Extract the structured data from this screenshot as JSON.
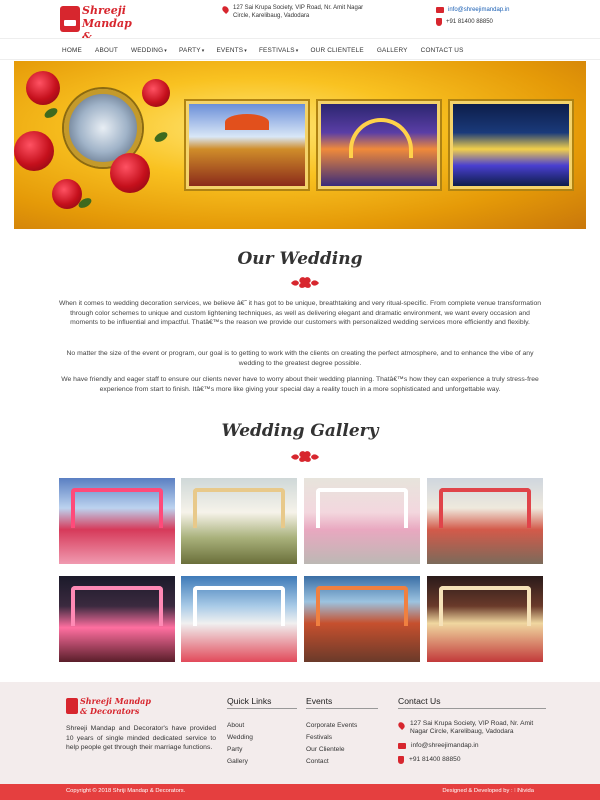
{
  "brand": {
    "name_line1": "Shreeji Mandap",
    "name_line2": "& Decorators"
  },
  "header": {
    "address": "127 Sai Krupa Society, VIP Road, Nr. Amit Nagar Circle, Karelibaug, Vadodara",
    "email": "info@shreejimandap.in",
    "phone": "+91 81400 88850"
  },
  "nav": [
    {
      "label": "HOME",
      "caret": ""
    },
    {
      "label": "ABOUT",
      "caret": ""
    },
    {
      "label": "WEDDING",
      "caret": "▾"
    },
    {
      "label": "PARTY",
      "caret": "▾"
    },
    {
      "label": "EVENTS",
      "caret": "▾"
    },
    {
      "label": "FESTIVALS",
      "caret": "▾"
    },
    {
      "label": "OUR CLIENTELE",
      "caret": ""
    },
    {
      "label": "GALLERY",
      "caret": ""
    },
    {
      "label": "CONTACT US",
      "caret": ""
    }
  ],
  "section1": {
    "title": "Our Wedding",
    "p1": "When it comes to wedding decoration services, we believe â€˜ it has got to be unique, breathtaking and very ritual-specific. From complete venue transformation through color schemes to unique and custom lightening techniques, as well as delivering elegant and dramatic environment, we want every occasion and moments to be influential and impactful. Thatâ€™s the reason we provide our customers with personalized wedding services more efficiently and flexibly.",
    "p2": "No matter the size of the event or program, our goal is to getting to work with the clients on creating the perfect atmosphere, and to enhance the vibe of any wedding to the greatest degree possible.",
    "p3": "We have friendly and eager staff to ensure our clients never have to worry about their wedding planning. Thatâ€™s how they can experience a truly stress-free experience from start to finish. Itâ€™s more like giving your special day a reality touch in a more sophisticated and unforgettable way."
  },
  "section2": {
    "title": "Wedding Gallery"
  },
  "footer": {
    "about": "Shreeji Mandap and Decorator's have provided 10 years of single minded dedicated service to help people get through their marriage functions.",
    "quick_links_title": "Quick Links",
    "quick_links": [
      "About",
      "Wedding",
      "Party",
      "Gallery"
    ],
    "events_title": "Events",
    "events": [
      "Corporate Events",
      "Festivals",
      "Our Clientele",
      "Contact"
    ],
    "contact_title": "Contact Us",
    "address": "127 Sai Krupa Society, VIP Road, Nr. Amit Nagar Circle, Karelibaug, Vadodara",
    "email": "info@shreejimandap.in",
    "phone": "+91 81400 88850"
  },
  "bottom": {
    "copyright": "Copyright © 2018 Shriji Mandap & Decorators.",
    "developed": "Designed & Developed by : ∷Nivida"
  },
  "colors": {
    "accent": "#d7262e",
    "bottom_bar": "#e53f3f",
    "footer_bg": "#f3ecec"
  }
}
